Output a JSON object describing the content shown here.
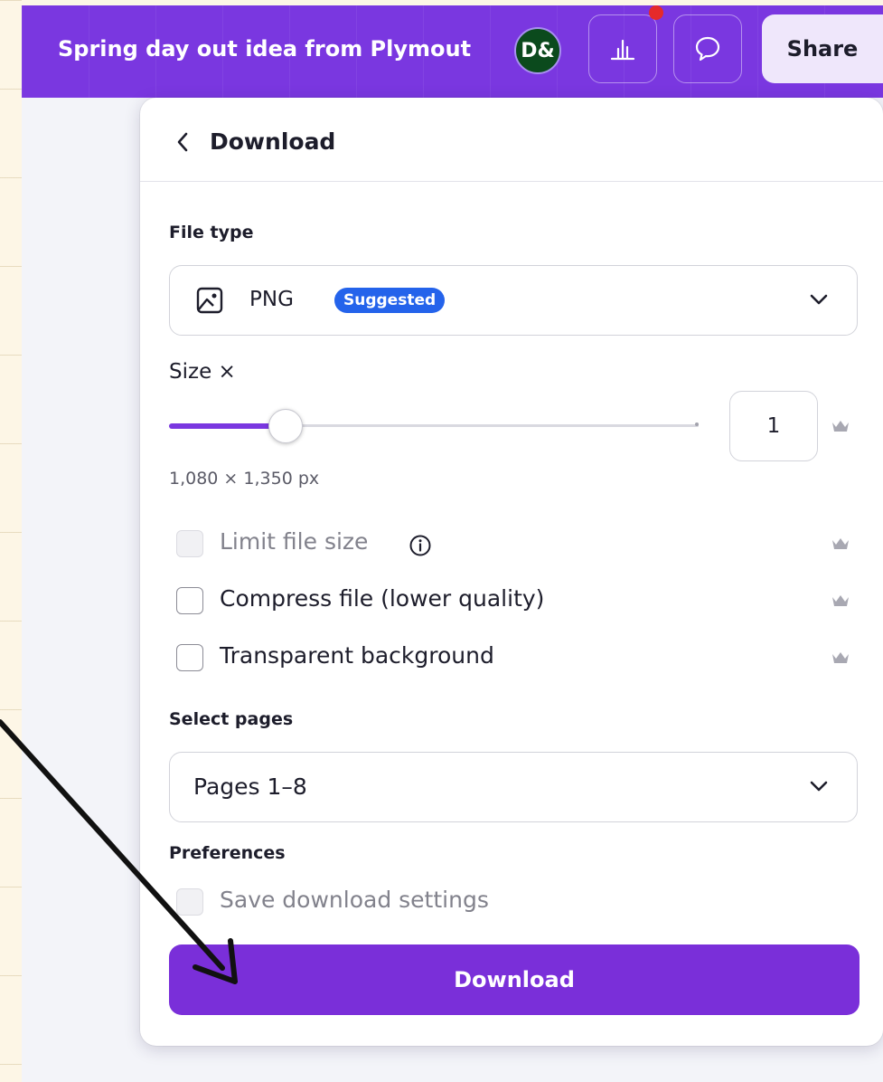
{
  "header": {
    "title": "Spring day out idea from Plymout",
    "avatar_initials": "D&",
    "share_label": "Share",
    "icons": [
      "insights-icon",
      "comment-icon"
    ],
    "notification_color": "#e52a2a",
    "brand_color": "#7a37e0"
  },
  "download_panel": {
    "title": "Download",
    "file_type": {
      "label": "File type",
      "value": "PNG",
      "badge": "Suggested",
      "icon": "image-icon"
    },
    "size": {
      "label": "Size ×",
      "value": "1",
      "slider_fraction": 0.22,
      "dimensions": "1,080 × 1,350 px"
    },
    "options": [
      {
        "label": "Limit file size",
        "checked": false,
        "disabled": true,
        "has_info": true,
        "premium": true
      },
      {
        "label": "Compress file (lower quality)",
        "checked": false,
        "disabled": false,
        "premium": true
      },
      {
        "label": "Transparent background",
        "checked": false,
        "disabled": false,
        "premium": true
      }
    ],
    "pages": {
      "label": "Select pages",
      "value": "Pages 1–8"
    },
    "preferences": {
      "label": "Preferences",
      "save_settings_label": "Save download settings",
      "save_settings_checked": false
    },
    "download_button": "Download"
  }
}
